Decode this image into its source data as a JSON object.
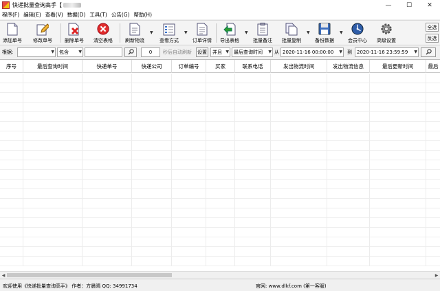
{
  "window": {
    "title": "快递批量查询高手【",
    "minimize": "—",
    "maximize": "☐",
    "close": "✕"
  },
  "menu": [
    "程序(F)",
    "编辑(E)",
    "查看(V)",
    "数据(D)",
    "工具(T)",
    "公告(G)",
    "帮助(H)"
  ],
  "toolbar": {
    "add": "添加单号",
    "modify": "修改单号",
    "delete": "删除单号",
    "clear": "清空表格",
    "refresh": "刷新物流",
    "view_mode": "查看方式",
    "order_detail": "订单详情",
    "export": "导出表格",
    "batch_note": "批量备注",
    "batch_copy": "批量复制",
    "backup": "备份数据",
    "member": "会员中心",
    "advanced": "高级设置",
    "select_all": "全选",
    "invert": "反选"
  },
  "filter": {
    "by_label": "根据:",
    "by_value": "",
    "match_value": "包含",
    "keyword": "",
    "search_icon": "search-icon",
    "seconds": "0",
    "auto_refresh_label": "秒后自动刷新",
    "settings": "设置",
    "logic": "并且",
    "time_field": "最后查询时间",
    "from_label": "从",
    "from_date": "2020-11-16 00:00:00",
    "to_label": "到",
    "to_date": "2020-11-16 23:59:59"
  },
  "table": {
    "columns": [
      "序号",
      "最后查询时间",
      "快递单号",
      "快递公司",
      "订单编号",
      "买家",
      "联系电话",
      "发出物流时间",
      "发出物流信息",
      "最后更新时间",
      "最后"
    ]
  },
  "status": {
    "welcome": "欢迎使用《快递批量查询高手》 作者：方晨晴  QQ: 34991734",
    "site": "官网: www.dlkf.com  (第一客服)"
  }
}
